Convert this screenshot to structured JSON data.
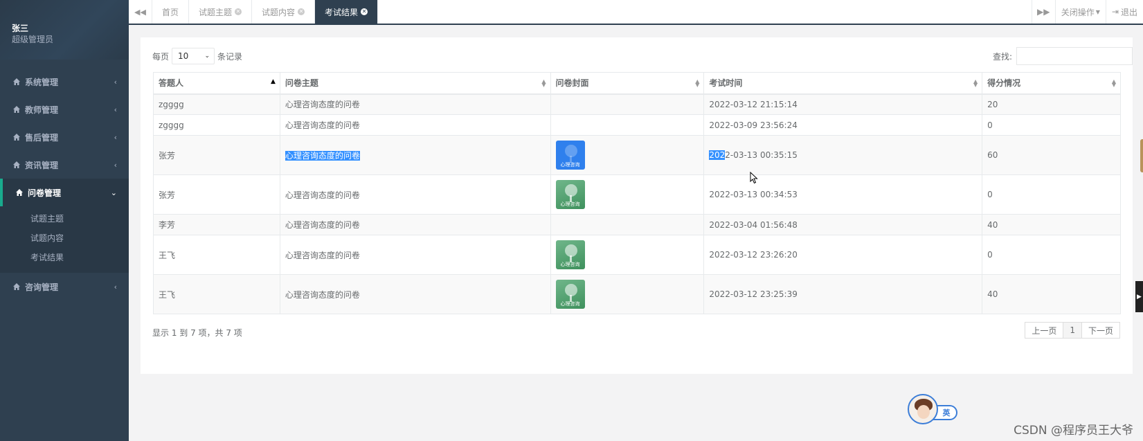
{
  "sidebar": {
    "user_name": "张三",
    "user_role": "超级管理员",
    "menu": [
      {
        "label": "系统管理",
        "icon": "home-icon",
        "chevron": "‹"
      },
      {
        "label": "教师管理",
        "icon": "home-icon",
        "chevron": "‹"
      },
      {
        "label": "售后管理",
        "icon": "home-icon",
        "chevron": "‹"
      },
      {
        "label": "资讯管理",
        "icon": "home-icon",
        "chevron": "‹"
      },
      {
        "label": "问卷管理",
        "icon": "home-icon",
        "chevron": "⌄",
        "expanded": true
      },
      {
        "label": "咨询管理",
        "icon": "home-icon",
        "chevron": "‹"
      }
    ],
    "submenu": [
      "试题主题",
      "试题内容",
      "考试结果"
    ]
  },
  "tabs": {
    "items": [
      {
        "label": "首页",
        "closable": false
      },
      {
        "label": "试题主题",
        "closable": true
      },
      {
        "label": "试题内容",
        "closable": true
      },
      {
        "label": "考试结果",
        "closable": true,
        "active": true
      }
    ],
    "close_ops": "关闭操作",
    "logout": "退出"
  },
  "toolbar": {
    "per_page_prefix": "每页",
    "per_page_value": "10",
    "per_page_suffix": "条记录",
    "search_label": "查找:",
    "search_value": ""
  },
  "table": {
    "columns": [
      "答题人",
      "问卷主题",
      "问卷封面",
      "考试时间",
      "得分情况"
    ],
    "rows": [
      {
        "answerer": "zgggg",
        "topic": "心理咨询态度的问卷",
        "cover": "",
        "time": "2022-03-12 21:15:14",
        "score": "20"
      },
      {
        "answerer": "zgggg",
        "topic": "心理咨询态度的问卷",
        "cover": "",
        "time": "2022-03-09 23:56:24",
        "score": "0"
      },
      {
        "answerer": "张芳",
        "topic": "心理咨询态度的问卷",
        "cover": "心理咨询",
        "time_sel": "202",
        "time_rest": "2-03-13 00:35:15",
        "score": "60"
      },
      {
        "answerer": "张芳",
        "topic": "心理咨询态度的问卷",
        "cover": "心理咨询",
        "time": "2022-03-13 00:34:53",
        "score": "0"
      },
      {
        "answerer": "李芳",
        "topic": "心理咨询态度的问卷",
        "cover": "",
        "time": "2022-03-04 01:56:48",
        "score": "40"
      },
      {
        "answerer": "王飞",
        "topic": "心理咨询态度的问卷",
        "cover": "心理咨询",
        "time": "2022-03-12 23:26:20",
        "score": "0"
      },
      {
        "answerer": "王飞",
        "topic": "心理咨询态度的问卷",
        "cover": "心理咨询",
        "time": "2022-03-12 23:25:39",
        "score": "40"
      }
    ]
  },
  "footer": {
    "info": "显示 1 到 7 项，共 7 项",
    "prev": "上一页",
    "page": "1",
    "next": "下一页"
  },
  "widget": {
    "lang": "英"
  },
  "watermark": "CSDN @程序员王大爷",
  "colors": {
    "sidebar": "#2f4050",
    "active_tab": "#2f4050",
    "selection": "#3390ff"
  }
}
